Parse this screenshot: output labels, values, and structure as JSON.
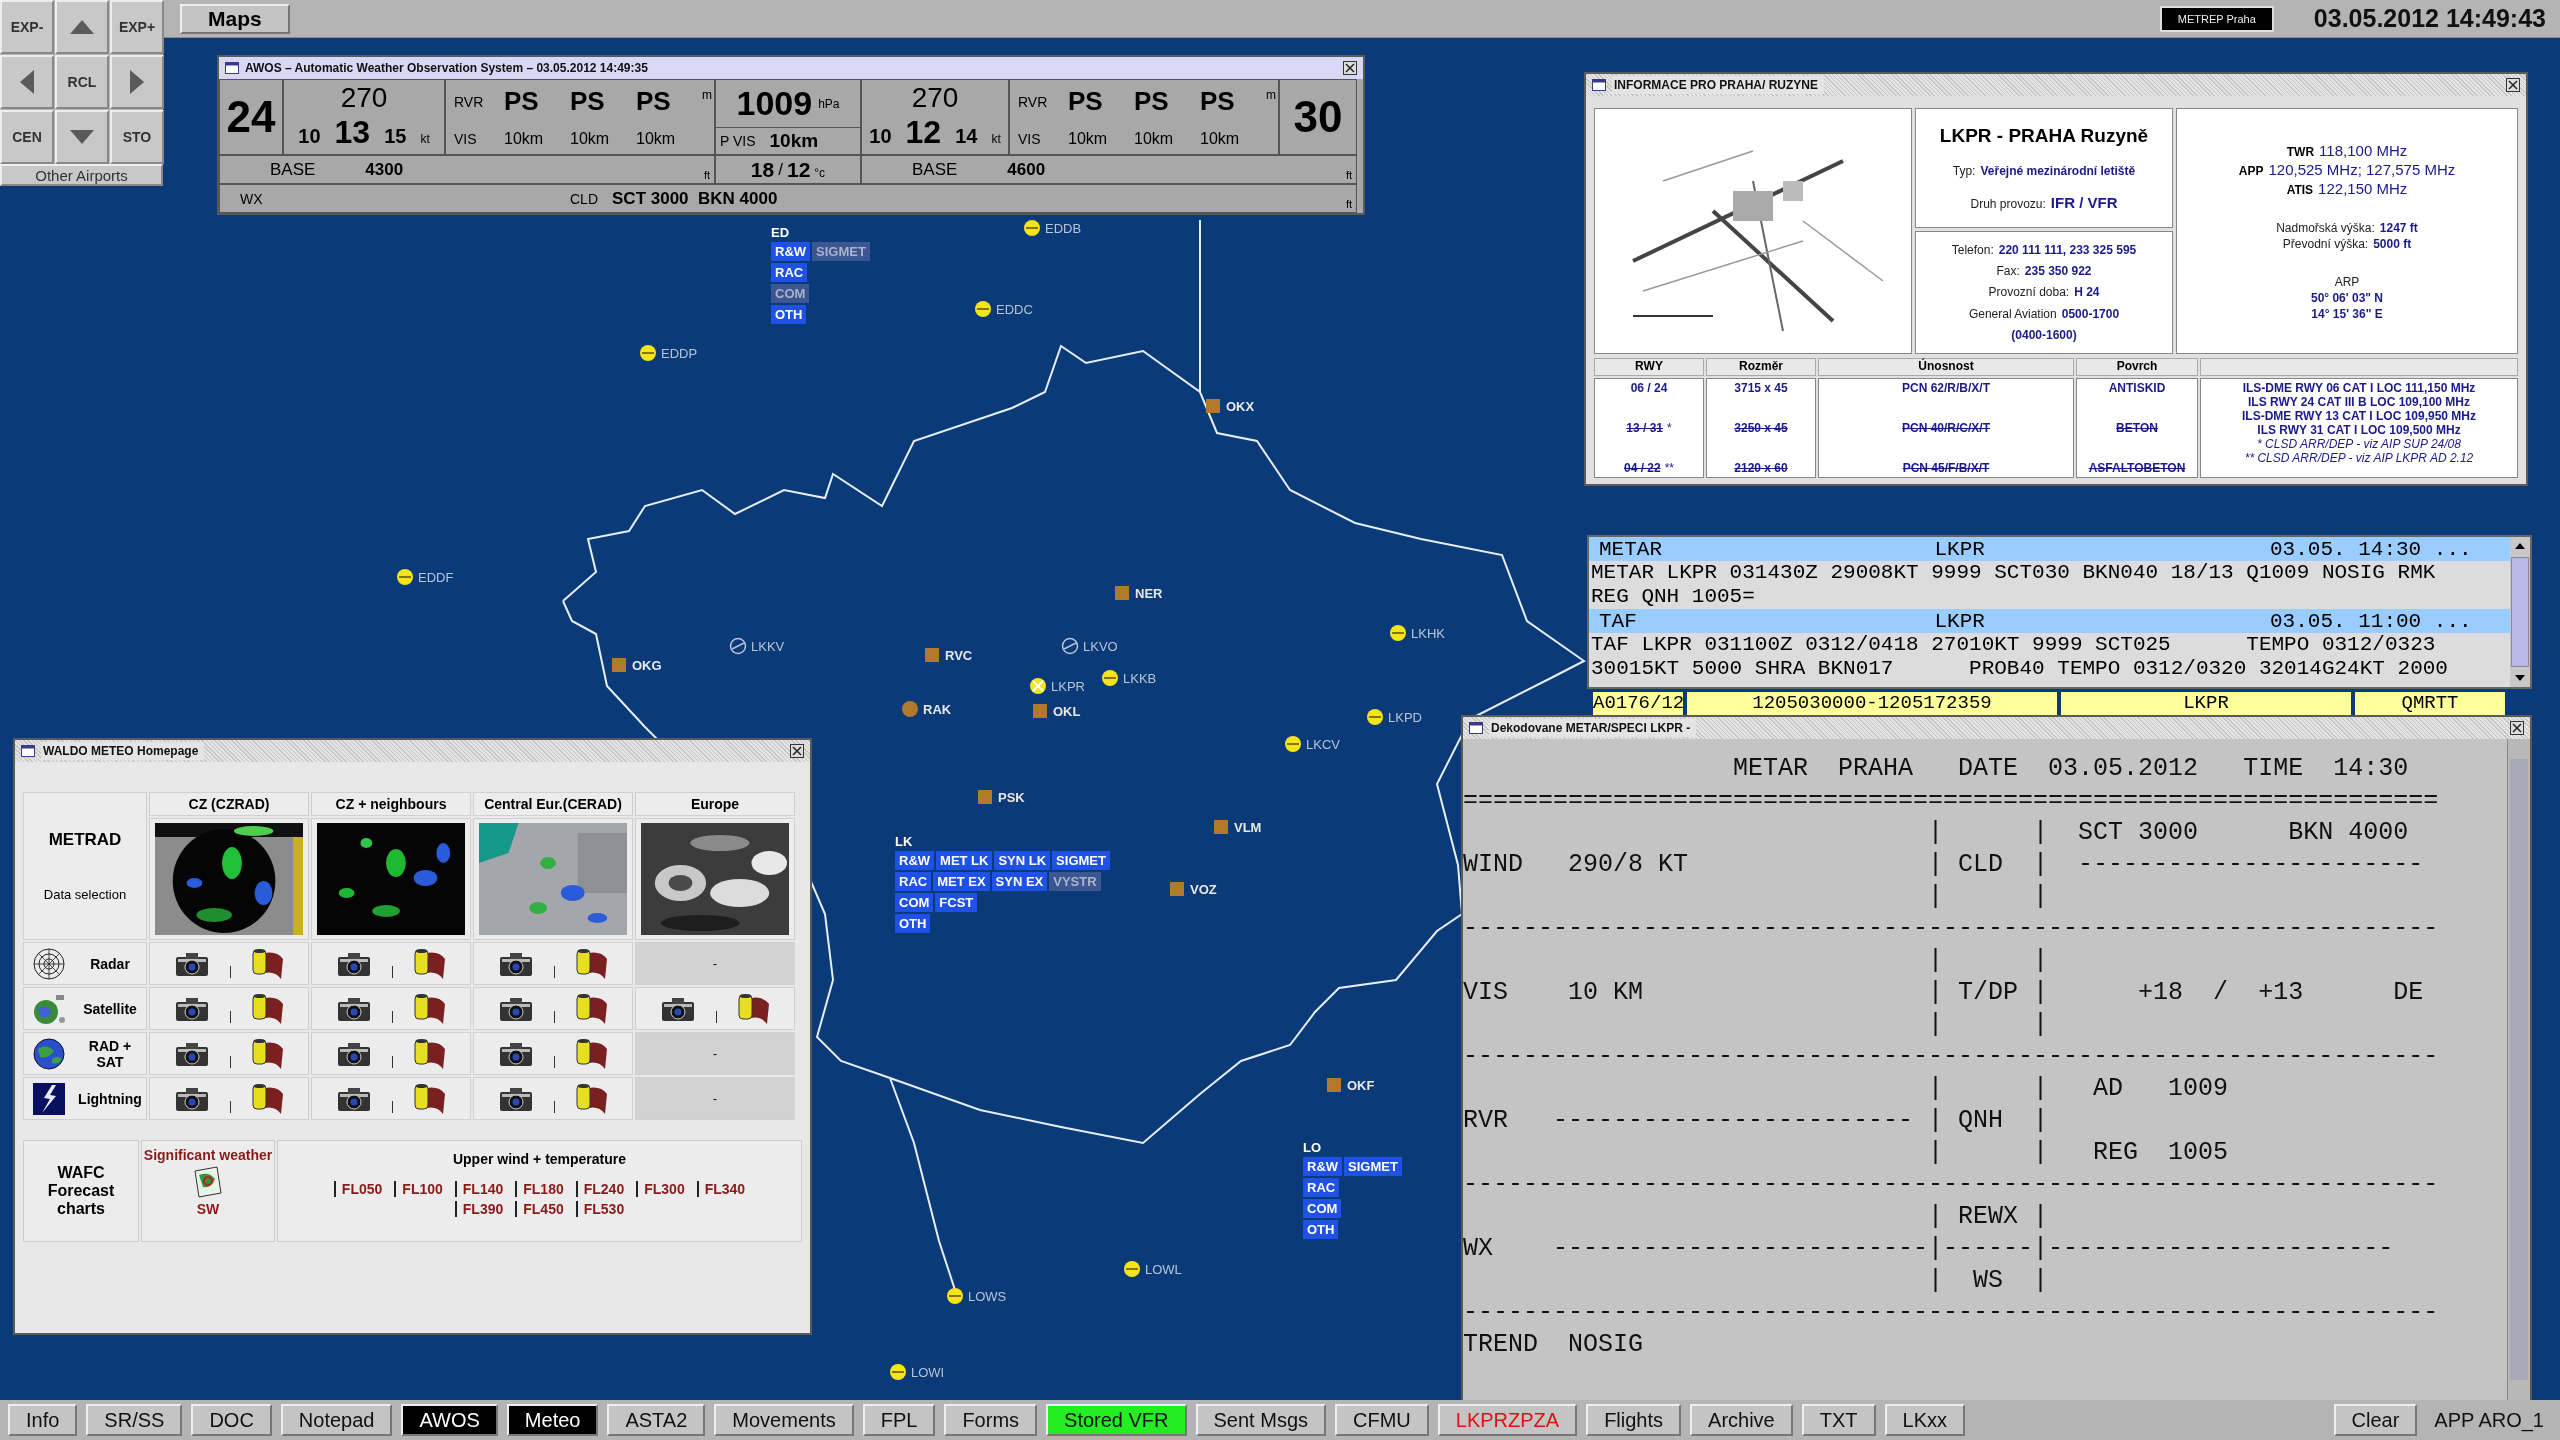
{
  "toolbar": {
    "tab": "Maps",
    "badge": "METREP Praha",
    "datetime": "03.05.2012 14:49:43"
  },
  "pad": {
    "keys": [
      {
        "kind": "text",
        "label": "EXP-"
      },
      {
        "kind": "up"
      },
      {
        "kind": "text",
        "label": "EXP+"
      },
      {
        "kind": "left"
      },
      {
        "kind": "text",
        "label": "RCL"
      },
      {
        "kind": "right"
      },
      {
        "kind": "text",
        "label": "CEN"
      },
      {
        "kind": "down"
      },
      {
        "kind": "text",
        "label": "STO"
      }
    ],
    "footer": "Other Airports"
  },
  "map": {
    "places": [
      {
        "kind": "airport",
        "name": "EDDB"
      },
      {
        "kind": "airport",
        "name": "EDDC"
      },
      {
        "kind": "airport",
        "name": "EDDP"
      },
      {
        "kind": "airport",
        "name": "EDDF"
      },
      {
        "kind": "point",
        "name": "OKX"
      },
      {
        "kind": "point",
        "name": "NER"
      },
      {
        "kind": "military",
        "name": "LKKV"
      },
      {
        "kind": "point",
        "name": "OKG"
      },
      {
        "kind": "point",
        "name": "RVC"
      },
      {
        "kind": "military",
        "name": "LKVO"
      },
      {
        "kind": "airport",
        "name": "LKHK"
      },
      {
        "kind": "airport",
        "name": "LKKB"
      },
      {
        "kind": "main",
        "name": "LKPR"
      },
      {
        "kind": "vor",
        "name": "RAK"
      },
      {
        "kind": "point",
        "name": "OKL"
      },
      {
        "kind": "airport",
        "name": "LKPD"
      },
      {
        "kind": "airport",
        "name": "LKCV"
      },
      {
        "kind": "point",
        "name": "PSK"
      },
      {
        "kind": "point",
        "name": "VLM"
      },
      {
        "kind": "point",
        "name": "VOZ"
      },
      {
        "kind": "point",
        "name": "OKF"
      },
      {
        "kind": "airport",
        "name": "LOWL"
      },
      {
        "kind": "airport",
        "name": "LOWS"
      },
      {
        "kind": "airport",
        "name": "LOWI"
      }
    ],
    "regions": [
      {
        "label": "ED",
        "rows": [
          [
            {
              "text": "R&W",
              "active": true
            },
            {
              "text": "SIGMET",
              "active": false
            }
          ],
          [
            {
              "text": "RAC",
              "active": true
            }
          ],
          [
            {
              "text": "COM",
              "active": false
            }
          ],
          [
            {
              "text": "OTH",
              "active": true
            }
          ]
        ]
      },
      {
        "label": "LK",
        "rows": [
          [
            {
              "text": "R&W",
              "active": true
            },
            {
              "text": "MET LK",
              "active": true
            },
            {
              "text": "SYN LK",
              "active": true
            },
            {
              "text": "SIGMET",
              "active": true
            }
          ],
          [
            {
              "text": "RAC",
              "active": true
            },
            {
              "text": "MET EX",
              "active": true
            },
            {
              "text": "SYN EX",
              "active": true
            },
            {
              "text": "VYSTR",
              "active": false
            }
          ],
          [
            {
              "text": "COM",
              "active": true
            },
            {
              "text": "FCST",
              "active": true
            }
          ],
          [
            {
              "text": "OTH",
              "active": true
            }
          ]
        ]
      },
      {
        "label": "LO",
        "rows": [
          [
            {
              "text": "R&W",
              "active": true
            },
            {
              "text": "SIGMET",
              "active": true
            }
          ],
          [
            {
              "text": "RAC",
              "active": true
            }
          ],
          [
            {
              "text": "COM",
              "active": true
            }
          ],
          [
            {
              "text": "OTH",
              "active": true
            }
          ]
        ]
      }
    ]
  },
  "awos": {
    "title": "AWOS – Automatic Weather Observation System – 03.05.2012 14:49:35",
    "sides": [
      {
        "runway": "24",
        "wind_dir": "270",
        "wind_min": "10",
        "wind_avg": "13",
        "wind_max": "15",
        "wind_unit": "kt",
        "rvr_label": "RVR",
        "rvr": [
          "PS",
          "PS",
          "PS"
        ],
        "rvr_unit": "m",
        "vis_label": "VIS",
        "vis": [
          "10km",
          "10km",
          "10km"
        ],
        "base_label": "BASE",
        "base": "4300",
        "base_unit": "ft"
      },
      {
        "runway": "30",
        "wind_dir": "270",
        "wind_min": "10",
        "wind_avg": "12",
        "wind_max": "14",
        "wind_unit": "kt",
        "rvr_label": "RVR",
        "rvr": [
          "PS",
          "PS",
          "PS"
        ],
        "rvr_unit": "m",
        "vis_label": "VIS",
        "vis": [
          "10km",
          "10km",
          "10km"
        ],
        "base_label": "BASE",
        "base": "4600",
        "base_unit": "ft"
      }
    ],
    "pressure": "1009",
    "pressure_unit": "hPa",
    "pvis_label": "P VIS",
    "pvis": "10km",
    "temp": "18",
    "temp_sep": "/",
    "dew": "12",
    "temp_unit": "°c",
    "wx_label": "WX",
    "cld_label": "CLD",
    "cld": "SCT 3000  BKN 4000",
    "cld_unit": "ft"
  },
  "info": {
    "title": "INFORMACE PRO PRAHA/  RUZYNE",
    "airport": "LKPR - PRAHA Ruzyně",
    "facts": [
      {
        "label": "Typ:",
        "value": "Veřejné mezinárodní letiště"
      },
      {
        "label": "Druh provozu:",
        "value": "IFR / VFR"
      }
    ],
    "contacts": [
      {
        "label": "Telefon:",
        "value": "220 111 111, 233 325 595"
      },
      {
        "label": "Fax:",
        "value": "235 350 922"
      },
      {
        "label": "Provozní doba:",
        "value": "H 24"
      },
      {
        "label": "General Aviation",
        "value": "0500-1700"
      }
    ],
    "hours_note": "(0400-1600)",
    "frequencies": [
      {
        "label": "TWR",
        "value": "118,100 MHz"
      },
      {
        "label": "APP",
        "value": "120,525 MHz; 127,575 MHz"
      },
      {
        "label": "ATIS",
        "value": "122,150 MHz"
      }
    ],
    "elevations": [
      {
        "label": "Nadmořská výška:",
        "value": "1247 ft"
      },
      {
        "label": "Převodní výška:",
        "value": "5000 ft"
      }
    ],
    "arp": {
      "label": "ARP",
      "lat": "50° 06' 03\" N",
      "lon": "14° 15' 36\" E"
    },
    "runway_columns": [
      "RWY",
      "Rozměr",
      "Únosnost",
      "Povrch"
    ],
    "runways": [
      {
        "rwy": "06 / 24",
        "size": "3715 x 45",
        "pcn": "PCN 62/R/B/X/T",
        "surface": "ANTISKID",
        "closed": false
      },
      {
        "rwy": "13 / 31",
        "note": "*",
        "size": "3250 x 45",
        "pcn": "PCN 40/R/C/X/T",
        "surface": "BETON",
        "closed": true
      },
      {
        "rwy": "04 / 22",
        "note": "**",
        "size": "2120 x 60",
        "pcn": "PCN 45/F/B/X/T",
        "surface": "ASFALTOBETON",
        "closed": true
      }
    ],
    "navaids": [
      {
        "kind": "ils",
        "text": "ILS-DME RWY 06 CAT I LOC 111,150 MHz"
      },
      {
        "kind": "ils",
        "text": "ILS RWY 24 CAT III B LOC 109,100 MHz"
      },
      {
        "kind": "ils",
        "text": "ILS-DME RWY 13 CAT I LOC 109,950 MHz"
      },
      {
        "kind": "ils",
        "text": "ILS RWY 31 CAT I LOC 109,500 MHz"
      },
      {
        "kind": "remark",
        "text": "* CLSD ARR/DEP - viz AIP SUP 24/08"
      },
      {
        "kind": "remark",
        "text": "** CLSD ARR/DEP - viz AIP LKPR AD 2.12"
      }
    ]
  },
  "reports": [
    {
      "type": "METAR",
      "station": "LKPR",
      "time": "03.05. 14:30 ...",
      "lines": [
        "METAR LKPR 031430Z 29008KT 9999 SCT030 BKN040 18/13 Q1009 NOSIG RMK",
        "REG QNH 1005="
      ]
    },
    {
      "type": "TAF",
      "station": "LKPR",
      "time": "03.05. 11:00 ...",
      "lines": [
        "TAF LKPR 031100Z 0312/0418 27010KT 9999 SCT025      TEMPO 0312/0323",
        "30015KT 5000 SHRA BKN017      PROB40 TEMPO 0312/0320 32014G24KT 2000"
      ]
    }
  ],
  "notam": [
    "A0176/12",
    "1205030000-1205172359",
    "LKPR",
    "QMRTT"
  ],
  "decoded": {
    "title": "Dekodovane METAR/SPECI LKPR -",
    "lines": [
      "                  METAR  PRAHA   DATE  03.05.2012   TIME  14:30",
      "=================================================================",
      "                               |      |  SCT 3000      BKN 4000",
      "WIND   290/8 KT                | CLD  |  -----------------------",
      "                               |      |",
      "-----------------------------------------------------------------",
      "                               |      |",
      "VIS    10 KM                   | T/DP |      +18  /  +13      DE",
      "                               |      |",
      "-----------------------------------------------------------------",
      "                               |      |   AD   1009",
      "RVR   ------------------------ | QNH  |",
      "                               |      |   REG  1005",
      "-----------------------------------------------------------------",
      "                               | REWX |",
      "WX    -------------------------|------|-----------------------",
      "                               |  WS  |",
      "-----------------------------------------------------------------",
      "TREND  NOSIG"
    ]
  },
  "waldo": {
    "title": "WALDO METEO Homepage",
    "corner_title": "METRAD",
    "corner_subtitle": "Data selection",
    "regions": [
      "CZ (CZRAD)",
      "CZ + neighbours",
      "Central Eur.(CERAD)",
      "Europe"
    ],
    "products": [
      {
        "kind": "radar",
        "label": "Radar",
        "cells": [
          {
            "available": true
          },
          {
            "available": true
          },
          {
            "available": true
          },
          {
            "available": false,
            "text": "-"
          }
        ]
      },
      {
        "kind": "satellite",
        "label": "Satellite",
        "cells": [
          {
            "available": true
          },
          {
            "available": true
          },
          {
            "available": true
          },
          {
            "available": true
          }
        ]
      },
      {
        "kind": "composite",
        "label": "RAD + SAT",
        "cells": [
          {
            "available": true
          },
          {
            "available": true
          },
          {
            "available": true
          },
          {
            "available": false,
            "text": "-"
          }
        ]
      },
      {
        "kind": "lightning",
        "label": "Lightning",
        "cells": [
          {
            "available": true
          },
          {
            "available": true
          },
          {
            "available": true
          },
          {
            "available": false,
            "text": "-"
          }
        ]
      }
    ],
    "wafc": "WAFC Forecast charts",
    "sigwx_title": "Significant weather",
    "sigwx_link": "SW",
    "upper_title": "Upper wind + temperature",
    "levels": [
      [
        "FL050",
        "FL100",
        "FL140",
        "FL180",
        "FL240",
        "FL300",
        "FL340"
      ],
      [
        "FL390",
        "FL450",
        "FL530"
      ]
    ]
  },
  "taskbar": {
    "buttons": [
      {
        "label": "Info",
        "kind": "normal",
        "selected": false
      },
      {
        "label": "SR/SS",
        "kind": "normal",
        "selected": false
      },
      {
        "label": "DOC",
        "kind": "normal",
        "selected": false
      },
      {
        "label": "Notepad",
        "kind": "normal",
        "selected": false
      },
      {
        "label": "AWOS",
        "kind": "normal",
        "selected": true
      },
      {
        "label": "Meteo",
        "kind": "normal",
        "selected": true
      },
      {
        "label": "ASTA2",
        "kind": "normal",
        "selected": false
      },
      {
        "label": "Movements",
        "kind": "normal",
        "selected": false
      },
      {
        "label": "FPL",
        "kind": "normal",
        "selected": false
      },
      {
        "label": "Forms",
        "kind": "normal",
        "selected": false
      },
      {
        "label": "Stored VFR",
        "kind": "ok",
        "selected": false
      },
      {
        "label": "Sent Msgs",
        "kind": "normal",
        "selected": false
      },
      {
        "label": "CFMU",
        "kind": "normal",
        "selected": false
      },
      {
        "label": "LKPRZPZA",
        "kind": "alert",
        "selected": false
      },
      {
        "label": "Flights",
        "kind": "normal",
        "selected": false
      },
      {
        "label": "Archive",
        "kind": "normal",
        "selected": false
      },
      {
        "label": "TXT",
        "kind": "normal",
        "selected": false
      },
      {
        "label": "LKxx",
        "kind": "normal",
        "selected": false
      }
    ],
    "clear": "Clear",
    "position": "APP ARO_1"
  }
}
